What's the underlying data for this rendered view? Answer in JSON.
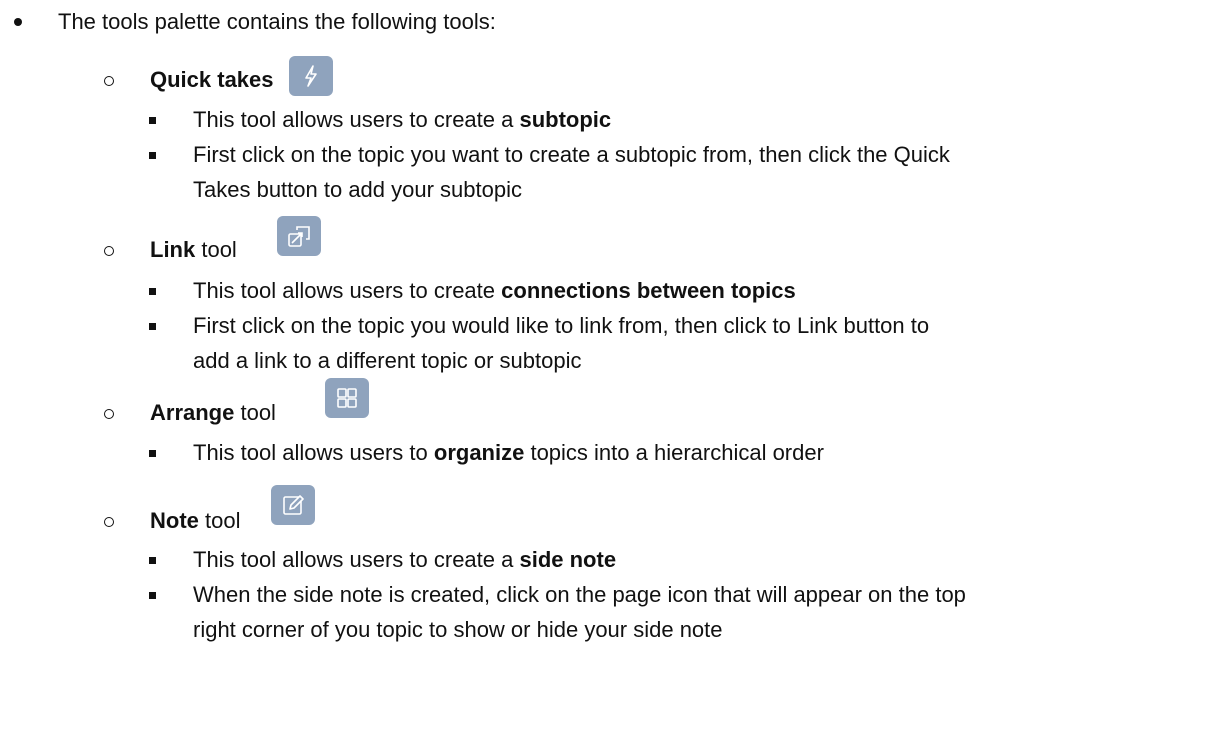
{
  "intro": "The tools palette contains the following tools:",
  "tools": [
    {
      "name": "Quick takes",
      "suffix": "",
      "icon": "lightning-icon",
      "items": [
        {
          "pre": "This tool allows users to create a ",
          "bold": "subtopic",
          "post": ""
        },
        {
          "lines": [
            "First click on the topic you want to create a subtopic from, then click the Quick",
            "Takes button to add your subtopic"
          ]
        }
      ]
    },
    {
      "name": "Link",
      "suffix": " tool",
      "icon": "link-icon",
      "items": [
        {
          "pre": "This tool allows users to create ",
          "bold": "connections between topics",
          "post": ""
        },
        {
          "lines": [
            "First click on the topic you would like to link from, then click to Link button to",
            "add a link to a different topic or subtopic"
          ]
        }
      ]
    },
    {
      "name": "Arrange",
      "suffix": " tool",
      "icon": "grid-icon",
      "items": [
        {
          "pre": "This tool allows users to ",
          "bold": "organize",
          "post": " topics into a hierarchical order"
        }
      ]
    },
    {
      "name": "Note",
      "suffix": " tool",
      "icon": "note-edit-icon",
      "items": [
        {
          "pre": "This tool allows users to create a ",
          "bold": "side note",
          "post": ""
        },
        {
          "lines": [
            "When the side note is created, click on the page icon that will appear on the top",
            "right corner of you topic to show or hide your side note"
          ]
        }
      ]
    }
  ],
  "colors": {
    "icon_bg": "#8fa3bd",
    "icon_fg": "#ffffff",
    "text": "#111111"
  }
}
